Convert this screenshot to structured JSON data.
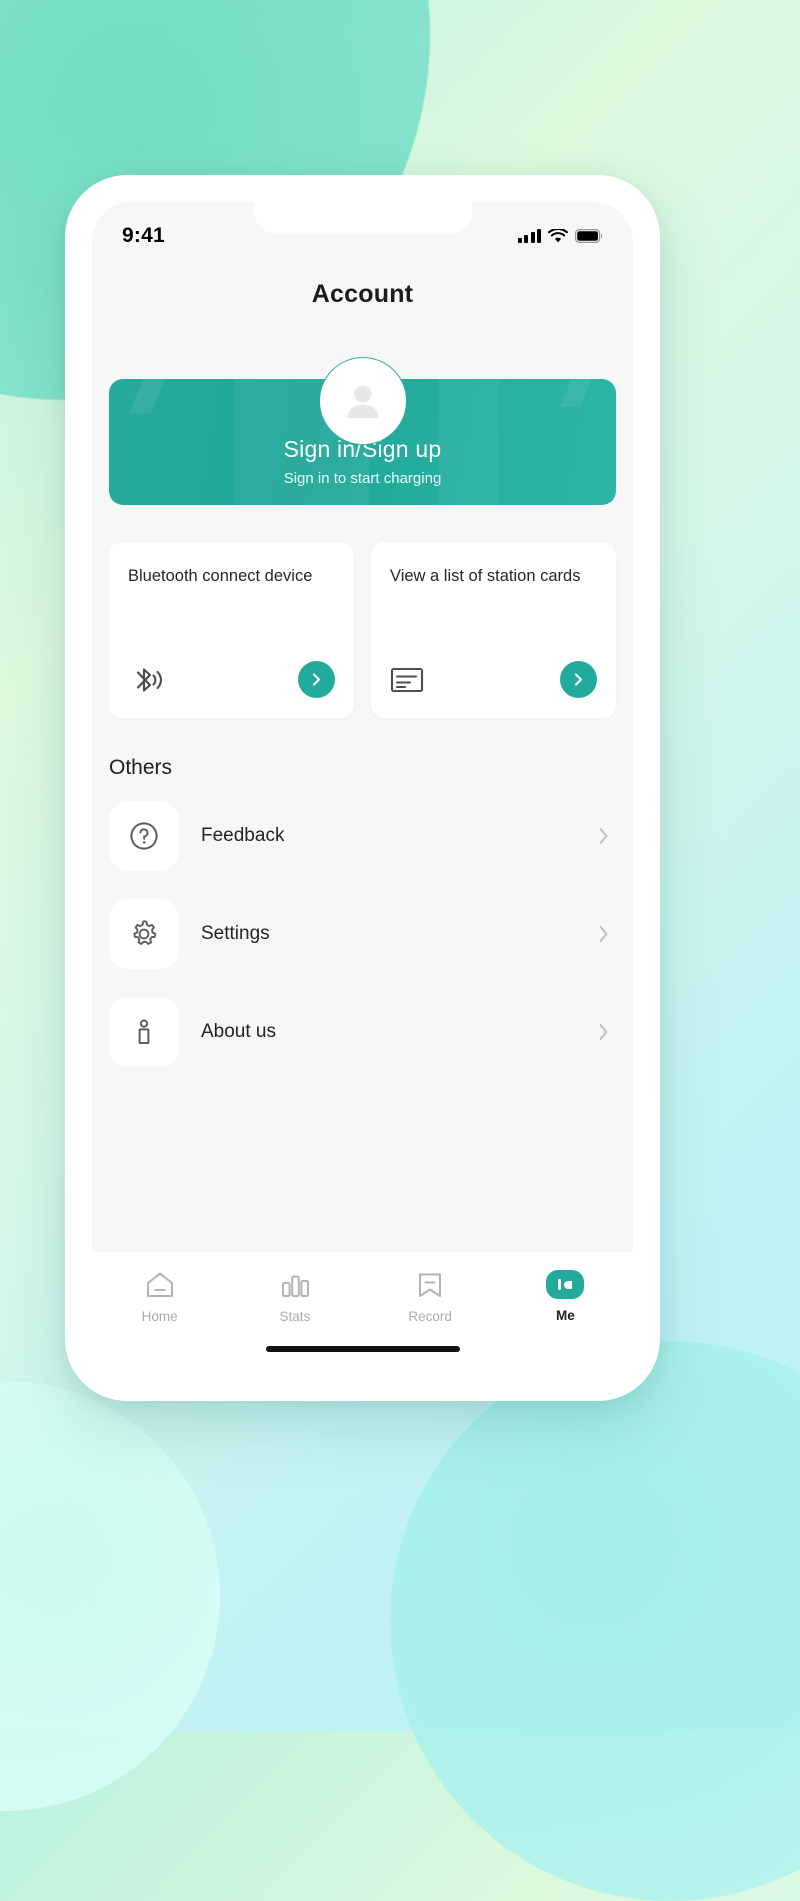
{
  "status_bar": {
    "time": "9:41",
    "signal_icon": "cellular-signal-icon",
    "wifi_icon": "wifi-icon",
    "battery_icon": "battery-icon"
  },
  "header": {
    "title": "Account"
  },
  "hero": {
    "title": "Sign in/Sign up",
    "subtitle": "Sign in to start charging",
    "avatar_icon": "user-avatar-icon",
    "background_color": "#22ab9c"
  },
  "action_cards": [
    {
      "title": "Bluetooth connect device",
      "icon": "bluetooth-searching-icon",
      "go_icon": "chevron-right-icon"
    },
    {
      "title": "View a list of station cards",
      "icon": "station-card-list-icon",
      "go_icon": "chevron-right-icon"
    }
  ],
  "others": {
    "heading": "Others",
    "items": [
      {
        "label": "Feedback",
        "icon": "question-circle-icon",
        "chevron": "chevron-right-icon"
      },
      {
        "label": "Settings",
        "icon": "gear-icon",
        "chevron": "chevron-right-icon"
      },
      {
        "label": "About us",
        "icon": "info-person-icon",
        "chevron": "chevron-right-icon"
      }
    ]
  },
  "tab_bar": {
    "items": [
      {
        "label": "Home",
        "icon": "home-icon",
        "active": false
      },
      {
        "label": "Stats",
        "icon": "bar-chart-icon",
        "active": false
      },
      {
        "label": "Record",
        "icon": "bookmark-icon",
        "active": false
      },
      {
        "label": "Me",
        "icon": "me-pill-icon",
        "active": true
      }
    ]
  },
  "theme": {
    "accent": "#22ab9c",
    "screen_background": "#f6f7f7",
    "card_background": "#ffffff",
    "muted_text": "#a9adad"
  }
}
